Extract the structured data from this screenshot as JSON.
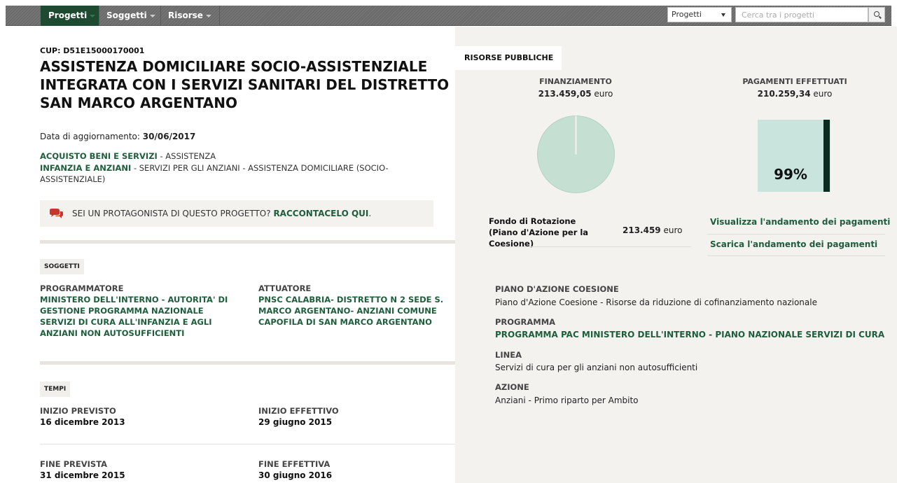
{
  "nav": {
    "tabs": [
      {
        "label": "Progetti"
      },
      {
        "label": "Soggetti"
      },
      {
        "label": "Risorse"
      }
    ],
    "search": {
      "select_value": "Progetti",
      "placeholder": "Cerca tra i progetti"
    }
  },
  "project": {
    "cup": "CUP: D51E15000170001",
    "title": "ASSISTENZA DOMICILIARE SOCIO-ASSISTENZIALE INTEGRATA CON I SERVIZI SANITARI DEL DISTRETTO SAN MARCO ARGENTANO",
    "update_label": "Data di aggiornamento:",
    "update_date": "30/06/2017",
    "category1_link": "ACQUISTO BENI E SERVIZI",
    "category1_rest": " - ASSISTENZA",
    "category2_link": "INFANZIA E ANZIANI",
    "category2_rest": " - SERVIZI PER GLI ANZIANI - ASSISTENZA DOMICILIARE (SOCIO-ASSISTENZIALE)",
    "protagonist_text": "SEI UN PROTAGONISTA DI QUESTO PROGETTO? ",
    "protagonist_link": "RACCONTACELO QUI",
    "protagonist_end": "."
  },
  "soggetti": {
    "label": "SOGGETTI",
    "programmatore_label": "PROGRAMMATORE",
    "programmatore_value": "MINISTERO DELL'INTERNO - AUTORITA' DI GESTIONE PROGRAMMA NAZIONALE SERVIZI DI CURA ALL'INFANZIA E AGLI ANZIANI NON AUTOSUFFICIENTI",
    "attuatore_label": "ATTUATORE",
    "attuatore_value": "PNSC CALABRIA- DISTRETTO N 2 SEDE S. MARCO ARGENTANO- ANZIANI COMUNE CAPOFILA DI SAN MARCO ARGENTANO"
  },
  "tempi": {
    "label": "TEMPI",
    "inizio_previsto_label": "INIZIO PREVISTO",
    "inizio_previsto": "16 dicembre 2013",
    "inizio_effettivo_label": "INIZIO EFFETTIVO",
    "inizio_effettivo": "29 giugno 2015",
    "fine_prevista_label": "FINE PREVISTA",
    "fine_prevista": "31 dicembre 2015",
    "fine_effettiva_label": "FINE EFFETTIVA",
    "fine_effettiva": "30 giugno 2016"
  },
  "risorse": {
    "tab_label": "RISORSE PUBBLICHE",
    "finanziamento_label": "FINANZIAMENTO",
    "finanziamento_value": "213.459,05",
    "pagamenti_label": "PAGAMENTI EFFETTUATI",
    "pagamenti_value": "210.259,34",
    "currency": "euro",
    "percent_paid": "99%",
    "percent_paid_fraction": 0.985,
    "fondo_name": "Fondo di Rotazione (Piano d'Azione per la Coesione)",
    "fondo_value": "213.459",
    "link_visualizza": "Visualizza l'andamento dei pagamenti",
    "link_scarica": "Scarica l'andamento dei pagamenti",
    "pie_color": "#c5e0d2",
    "bar_color": "#c9e4dc",
    "bar_fill_color": "#0b2a20"
  },
  "programma": {
    "piano_label": "PIANO D'AZIONE COESIONE",
    "piano_value": "Piano d'Azione Coesione - Risorse da riduzione di cofinanziamento nazionale",
    "programma_label": "PROGRAMMA",
    "programma_value": "PROGRAMMA PAC MINISTERO DELL'INTERNO - PIANO NAZIONALE SERVIZI DI CURA",
    "linea_label": "LINEA",
    "linea_value": "Servizi di cura per gli anziani non autosufficienti",
    "azione_label": "AZIONE",
    "azione_value": "Anziani - Primo riparto per Ambito"
  }
}
